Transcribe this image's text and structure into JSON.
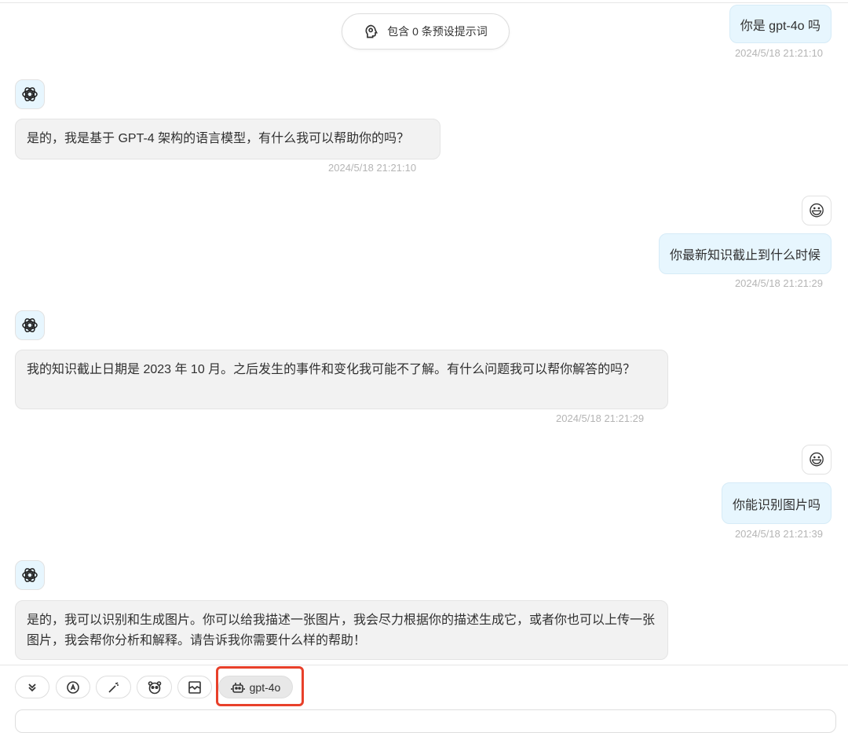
{
  "prompt_pill": {
    "label": "包含 0 条预设提示词",
    "icon": "brain-icon"
  },
  "messages": [
    {
      "role": "user",
      "text": "你是 gpt-4o 吗",
      "time": "2024/5/18 21:21:10"
    },
    {
      "role": "assistant",
      "text": "是的，我是基于 GPT-4 架构的语言模型，有什么我可以帮助你的吗？",
      "time": "2024/5/18 21:21:10"
    },
    {
      "role": "user",
      "avatar": "😃",
      "text": "你最新知识截止到什么时候",
      "time": "2024/5/18 21:21:29"
    },
    {
      "role": "assistant",
      "text": "我的知识截止日期是 2023 年 10 月。之后发生的事件和变化我可能不了解。有什么问题我可以帮你解答的吗？",
      "time": "2024/5/18 21:21:29"
    },
    {
      "role": "user",
      "avatar": "😃",
      "text": "你能识别图片吗",
      "time": "2024/5/18 21:21:39"
    },
    {
      "role": "assistant",
      "text": "是的，我可以识别和生成图片。你可以给我描述一张图片，我会尽力根据你的描述生成它，或者你也可以上传一张图片，我会帮你分析和解释。请告诉我你需要什么样的帮助！"
    }
  ],
  "toolbar": {
    "model_label": "gpt-4o"
  },
  "colors": {
    "highlight": "#e8402a",
    "user_bubble": "#e7f6fe",
    "bot_bubble": "#f2f2f2"
  }
}
